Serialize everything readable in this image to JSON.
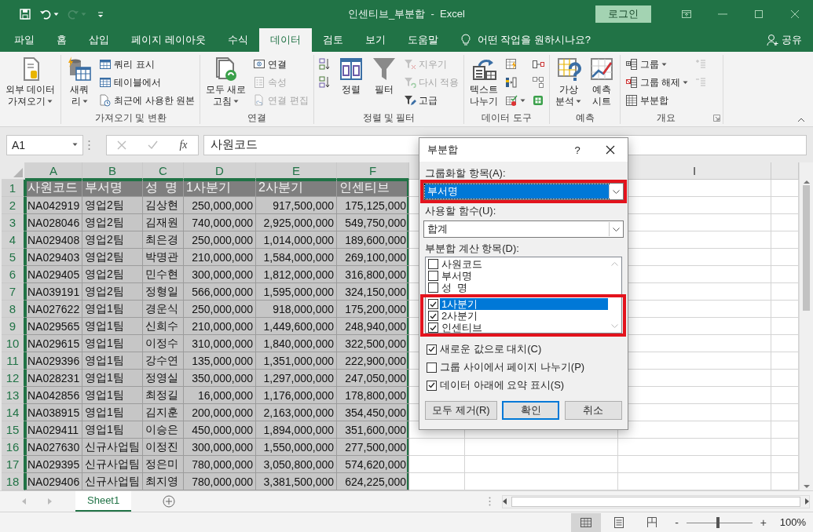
{
  "title_bar": {
    "quick_access": [
      {
        "kind": "save",
        "dropdown": false,
        "disabled": false
      },
      {
        "kind": "undo",
        "dropdown": true,
        "disabled": false
      },
      {
        "kind": "redo",
        "dropdown": true,
        "disabled": true
      },
      {
        "kind": "customize",
        "dropdown": false,
        "disabled": false
      }
    ],
    "title": "인센티브_부분합  -  Excel",
    "sign_in": "로그인"
  },
  "menu_tabs": [
    {
      "label": "파일",
      "selected": false
    },
    {
      "label": "홈",
      "selected": false
    },
    {
      "label": "삽입",
      "selected": false
    },
    {
      "label": "페이지 레이아웃",
      "selected": false
    },
    {
      "label": "수식",
      "selected": false
    },
    {
      "label": "데이터",
      "selected": true
    },
    {
      "label": "검토",
      "selected": false
    },
    {
      "label": "보기",
      "selected": false
    },
    {
      "label": "도움말",
      "selected": false
    }
  ],
  "tell_me": "어떤 작업을 원하시나요?",
  "share": "공유",
  "ribbon": {
    "groups": [
      {
        "launcher": false,
        "items": [
          {
            "kind": "large",
            "lines": [
              "외부 데이터",
              "가져오기"
            ],
            "dropdown": true,
            "disabled": false
          }
        ]
      },
      {
        "label": "가져오기 및 변환",
        "launcher": false,
        "items": [
          {
            "kind": "large",
            "lines": [
              "새쿼",
              "리"
            ],
            "dropdown": true,
            "disabled": false
          },
          {
            "kind": "small",
            "label": "쿼리 표시",
            "dropdown": false,
            "disabled": false
          },
          {
            "kind": "small",
            "label": "테이블에서",
            "dropdown": false,
            "disabled": false
          },
          {
            "kind": "small",
            "label": "최근에 사용한 원본",
            "dropdown": false,
            "disabled": false
          }
        ]
      },
      {
        "label": "연결",
        "launcher": false,
        "items": [
          {
            "kind": "large",
            "lines": [
              "모두 새로",
              "고침"
            ],
            "dropdown": true,
            "disabled": false
          },
          {
            "kind": "small",
            "label": "연결",
            "dropdown": false,
            "disabled": false
          },
          {
            "kind": "small",
            "label": "속성",
            "dropdown": false,
            "disabled": true
          },
          {
            "kind": "small",
            "label": "연결 편집",
            "dropdown": false,
            "disabled": true
          }
        ]
      },
      {
        "label": "정렬 및 필터",
        "launcher": false,
        "items": [
          {
            "kind": "icon",
            "dropdown": false,
            "disabled": false
          },
          {
            "kind": "icon",
            "dropdown": false,
            "disabled": false
          },
          {
            "kind": "large",
            "lines": [
              "정렬"
            ],
            "dropdown": false,
            "disabled": false
          },
          {
            "kind": "large",
            "lines": [
              "필터"
            ],
            "dropdown": false,
            "disabled": false
          },
          {
            "kind": "small",
            "label": "지우기",
            "dropdown": false,
            "disabled": true
          },
          {
            "kind": "small",
            "label": "다시 적용",
            "dropdown": false,
            "disabled": true
          },
          {
            "kind": "small",
            "label": "고급",
            "dropdown": false,
            "disabled": false
          }
        ]
      },
      {
        "label": "데이터 도구",
        "launcher": false,
        "items": [
          {
            "kind": "large",
            "lines": [
              "텍스트",
              "나누기"
            ],
            "dropdown": false,
            "disabled": false
          },
          {
            "kind": "icon",
            "dropdown": false,
            "disabled": false
          },
          {
            "kind": "icon",
            "dropdown": false,
            "disabled": false
          },
          {
            "kind": "icon",
            "dropdown": true,
            "disabled": false
          },
          {
            "kind": "icon",
            "dropdown": false,
            "disabled": false
          },
          {
            "kind": "icon",
            "dropdown": false,
            "disabled": false
          },
          {
            "kind": "icon",
            "dropdown": false,
            "disabled": false
          }
        ]
      },
      {
        "label": "예측",
        "launcher": false,
        "items": [
          {
            "kind": "large",
            "lines": [
              "가상",
              "분석"
            ],
            "dropdown": true,
            "disabled": false
          },
          {
            "kind": "large",
            "lines": [
              "예측",
              "시트"
            ],
            "dropdown": false,
            "disabled": false
          }
        ]
      },
      {
        "label": "개요",
        "launcher": true,
        "items": [
          {
            "kind": "small",
            "label": "그룹",
            "dropdown": true,
            "disabled": false
          },
          {
            "kind": "small",
            "label": "그룹 해제",
            "dropdown": true,
            "disabled": false
          },
          {
            "kind": "small",
            "label": "부분합",
            "dropdown": false,
            "disabled": false
          },
          {
            "kind": "icon",
            "dropdown": false,
            "disabled": true
          },
          {
            "kind": "icon",
            "dropdown": false,
            "disabled": true
          }
        ]
      }
    ]
  },
  "formula_bar": {
    "name_box": "A1",
    "function_label": "fx",
    "content": "사원코드"
  },
  "sheet": {
    "columns": [
      {
        "letter": "A",
        "selected": true
      },
      {
        "letter": "B",
        "selected": true
      },
      {
        "letter": "C",
        "selected": true
      },
      {
        "letter": "D",
        "selected": true
      },
      {
        "letter": "E",
        "selected": true
      },
      {
        "letter": "F",
        "selected": true
      }
    ],
    "far_column": {
      "letter": "I",
      "selected": false
    },
    "rows": [
      {
        "number": "1",
        "kind": "title",
        "selected": true,
        "cells": [
          "사원코드",
          "부서명",
          "성  명",
          "1사분기",
          "2사분기",
          "인센티브"
        ]
      },
      {
        "number": "2",
        "kind": "data",
        "selected": true,
        "cells": [
          "NA042919",
          "영업2팀",
          "김상현",
          "250,000,000",
          "917,500,000",
          "175,125,000"
        ]
      },
      {
        "number": "3",
        "kind": "data",
        "selected": true,
        "cells": [
          "NA028046",
          "영업2팀",
          "김재원",
          "740,000,000",
          "2,925,000,000",
          "549,750,000"
        ]
      },
      {
        "number": "4",
        "kind": "data",
        "selected": true,
        "cells": [
          "NA029408",
          "영업2팀",
          "최은경",
          "250,000,000",
          "1,014,000,000",
          "189,600,000"
        ]
      },
      {
        "number": "5",
        "kind": "data",
        "selected": true,
        "cells": [
          "NA029403",
          "영업2팀",
          "박명관",
          "210,000,000",
          "1,584,000,000",
          "269,100,000"
        ]
      },
      {
        "number": "6",
        "kind": "data",
        "selected": true,
        "cells": [
          "NA029405",
          "영업2팀",
          "민수현",
          "300,000,000",
          "1,812,000,000",
          "316,800,000"
        ]
      },
      {
        "number": "7",
        "kind": "data",
        "selected": true,
        "cells": [
          "NA039191",
          "영업2팀",
          "정형일",
          "566,000,000",
          "1,595,000,000",
          "324,150,000"
        ]
      },
      {
        "number": "8",
        "kind": "data",
        "selected": true,
        "cells": [
          "NA027622",
          "영업1팀",
          "경운식",
          "250,000,000",
          "918,000,000",
          "175,200,000"
        ]
      },
      {
        "number": "9",
        "kind": "data",
        "selected": true,
        "cells": [
          "NA029565",
          "영업1팀",
          "신희수",
          "210,000,000",
          "1,449,600,000",
          "248,940,000"
        ]
      },
      {
        "number": "10",
        "kind": "data",
        "selected": true,
        "cells": [
          "NA029615",
          "영업1팀",
          "이정수",
          "310,000,000",
          "1,840,000,000",
          "322,500,000"
        ]
      },
      {
        "number": "11",
        "kind": "data",
        "selected": true,
        "cells": [
          "NA029396",
          "영업1팀",
          "강수연",
          "135,000,000",
          "1,351,000,000",
          "222,900,000"
        ]
      },
      {
        "number": "12",
        "kind": "data",
        "selected": true,
        "cells": [
          "NA028231",
          "영업1팀",
          "정영실",
          "350,000,000",
          "1,297,000,000",
          "247,050,000"
        ]
      },
      {
        "number": "13",
        "kind": "data",
        "selected": true,
        "cells": [
          "NA042856",
          "영업1팀",
          "최정길",
          "16,000,000",
          "1,176,000,000",
          "178,800,000"
        ]
      },
      {
        "number": "14",
        "kind": "data",
        "selected": true,
        "cells": [
          "NA038915",
          "영업1팀",
          "김지훈",
          "200,000,000",
          "2,163,000,000",
          "354,450,000"
        ]
      },
      {
        "number": "15",
        "kind": "data",
        "selected": true,
        "cells": [
          "NA029411",
          "영업1팀",
          "이승은",
          "450,000,000",
          "1,894,000,000",
          "351,600,000"
        ]
      },
      {
        "number": "16",
        "kind": "data",
        "selected": true,
        "cells": [
          "NA027630",
          "신규사업팀",
          "이정진",
          "300,000,000",
          "1,550,000,000",
          "277,500,000"
        ]
      },
      {
        "number": "17",
        "kind": "data",
        "selected": true,
        "cells": [
          "NA029395",
          "신규사업팀",
          "정은미",
          "780,000,000",
          "3,050,800,000",
          "574,620,000"
        ]
      },
      {
        "number": "18",
        "kind": "data",
        "selected": true,
        "cells": [
          "NA029406",
          "신규사업팀",
          "최지영",
          "780,000,000",
          "3,381,500,000",
          "624,225,000"
        ]
      }
    ]
  },
  "sheet_tabs": [
    {
      "label": "Sheet1",
      "selected": true
    }
  ],
  "status_bar": {
    "views": [
      {
        "kind": "normal",
        "selected": true
      },
      {
        "kind": "page_layout",
        "selected": false
      },
      {
        "kind": "page_break",
        "selected": false
      }
    ],
    "zoom": {
      "minus": "-",
      "plus": "+",
      "level": 0.48,
      "reading": "100%"
    }
  },
  "dialog": {
    "title": "부분합",
    "help": "?",
    "group_by": {
      "label": "그룹화할 항목(A):",
      "value": "부서명",
      "focused": true,
      "highlighted": true
    },
    "function": {
      "label": "사용할 함수(U):",
      "value": "합계",
      "focused": false,
      "highlighted": false
    },
    "fields_label": "부분합 계산 항목(D):",
    "fields": [
      {
        "label": "사원코드",
        "checked": false,
        "selected": false,
        "highlighted": false
      },
      {
        "label": "부서명",
        "checked": false,
        "selected": false,
        "highlighted": false
      },
      {
        "label": "성  명",
        "checked": false,
        "selected": false,
        "highlighted": false
      },
      {
        "label": "1사분기",
        "checked": true,
        "selected": true,
        "highlighted": true
      },
      {
        "label": "2사분기",
        "checked": true,
        "selected": false,
        "highlighted": true
      },
      {
        "label": "인센티브",
        "checked": true,
        "selected": false,
        "highlighted": true
      }
    ],
    "options": [
      {
        "label": "새로운 값으로 대치(C)",
        "checked": true
      },
      {
        "label": "그룹 사이에서 페이지 나누기(P)",
        "checked": false
      },
      {
        "label": "데이터 아래에 요약 표시(S)",
        "checked": true
      }
    ],
    "buttons": [
      {
        "label": "모두 제거(R)",
        "default": false
      },
      {
        "label": "확인",
        "default": true
      },
      {
        "label": "취소",
        "default": false
      }
    ]
  }
}
